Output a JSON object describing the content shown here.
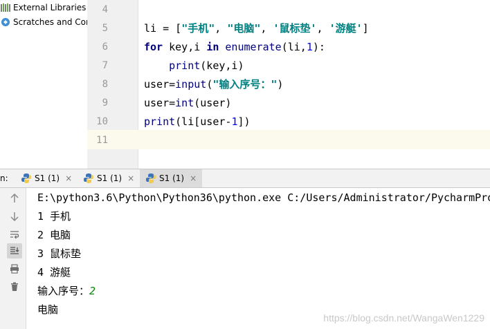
{
  "project_tree": {
    "items": [
      {
        "label": "External Libraries",
        "icon": "library-icon"
      },
      {
        "label": "Scratches and Cor",
        "icon": "scratches-icon"
      }
    ]
  },
  "editor": {
    "lines": [
      {
        "num": "4"
      },
      {
        "num": "5"
      },
      {
        "num": "6"
      },
      {
        "num": "7"
      },
      {
        "num": "8"
      },
      {
        "num": "9"
      },
      {
        "num": "10"
      },
      {
        "num": "11"
      }
    ],
    "code": {
      "l5": {
        "a": "li = [",
        "s1": "\"手机\"",
        "c1": ", ",
        "s2": "\"电脑\"",
        "c2": ", ",
        "s3": "'鼠标垫'",
        "c3": ", ",
        "s4": "'游艇'",
        "z": "]"
      },
      "l6": {
        "kw1": "for",
        "a": " key,i ",
        "kw2": "in",
        "b": " ",
        "fn": "enumerate",
        "c": "(li,",
        "n": "1",
        "d": "):"
      },
      "l7": {
        "indent": "    ",
        "fn": "print",
        "a": "(key,i)"
      },
      "l8": {
        "a": "user=",
        "fn": "input",
        "b": "(",
        "s": "\"输入序号：\"",
        "c": ")"
      },
      "l9": {
        "a": "user=",
        "fn": "int",
        "b": "(user)"
      },
      "l10": {
        "fn": "print",
        "a": "(li[user-",
        "n": "1",
        "b": "])"
      }
    }
  },
  "run_panel": {
    "label": "n:",
    "tabs": [
      {
        "label": "S1 (1)",
        "close": "×"
      },
      {
        "label": "S1 (1)",
        "close": "×"
      },
      {
        "label": "S1 (1)",
        "close": "×"
      }
    ],
    "side_buttons": [
      "up-arrow-icon",
      "down-arrow-icon",
      "soft-wrap-icon",
      "scroll-to-end-icon",
      "print-icon",
      "trash-icon"
    ]
  },
  "console": {
    "lines": [
      "E:\\python3.6\\Python\\Python36\\python.exe C:/Users/Administrator/PycharmPro",
      "1 手机",
      "2 电脑",
      "3 鼠标垫",
      "4 游艇"
    ],
    "prompt": "输入序号：",
    "input_value": "2",
    "result": "电脑",
    "watermark": "https://blog.csdn.net/WangaWen1229"
  },
  "colors": {
    "keyword": "#000080",
    "string": "#008080",
    "number": "#0000ff",
    "user_input": "#0a8a0a",
    "current_line": "#fcfaed"
  }
}
